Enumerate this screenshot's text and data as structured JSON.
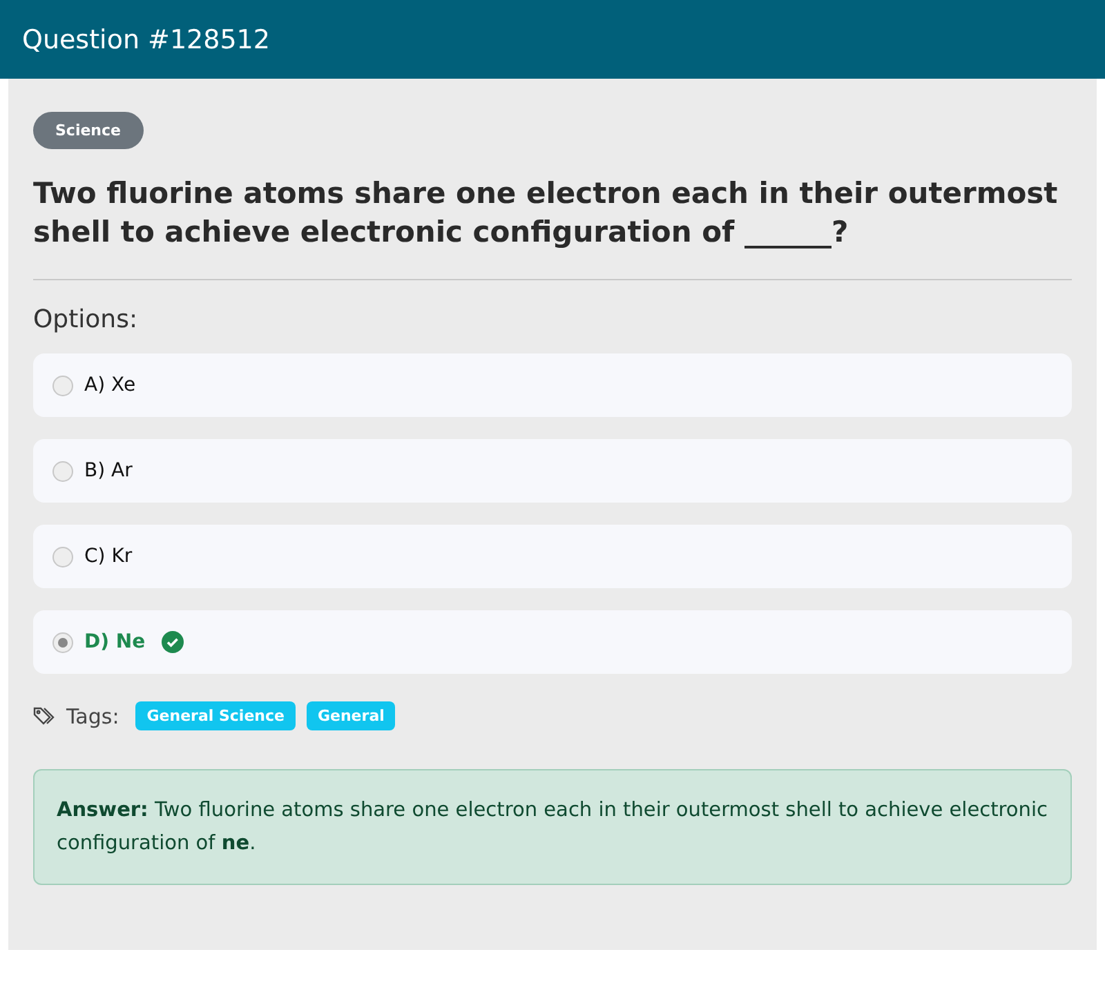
{
  "header": {
    "title": "Question #128512"
  },
  "category": "Science",
  "question": "Two fluorine atoms share one electron each in their outermost shell to achieve electronic configuration of ______?",
  "options_label": "Options:",
  "options": [
    {
      "label": "A) Xe",
      "selected": false,
      "correct": false
    },
    {
      "label": "B) Ar",
      "selected": false,
      "correct": false
    },
    {
      "label": "C) Kr",
      "selected": false,
      "correct": false
    },
    {
      "label": "D) Ne",
      "selected": true,
      "correct": true
    }
  ],
  "tags_label": "Tags:",
  "tags": [
    "General Science",
    "General"
  ],
  "answer": "**Answer:** Two fluorine atoms share one electron each in their outermost shell to achieve electronic configuration of **ne**."
}
